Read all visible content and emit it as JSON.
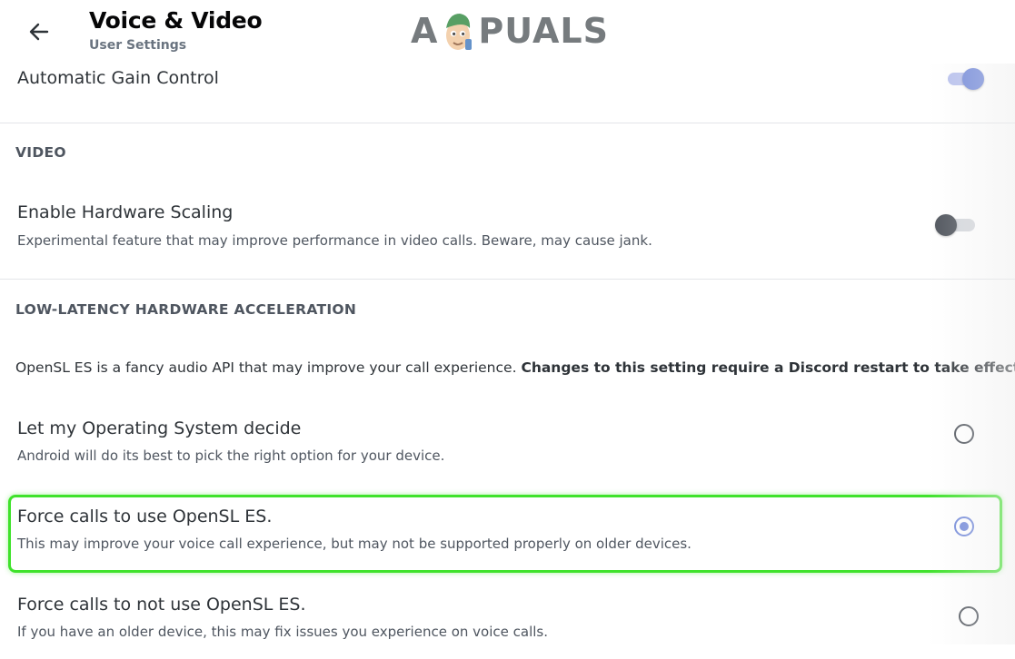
{
  "header": {
    "title": "Voice & Video",
    "subtitle": "User Settings",
    "back_icon": "arrow-left-icon"
  },
  "watermark": {
    "text_left": "A",
    "text_right": "PUALS"
  },
  "agc": {
    "label": "Automatic Gain Control",
    "enabled": true
  },
  "video": {
    "section_title": "VIDEO",
    "hw_scaling": {
      "label": "Enable Hardware Scaling",
      "description": "Experimental feature that may improve performance in video calls. Beware, may cause jank.",
      "enabled": false
    }
  },
  "low_latency": {
    "section_title": "LOW-LATENCY HARDWARE ACCELERATION",
    "note_plain": "OpenSL ES is a fancy audio API that may improve your call experience.",
    "note_bold": "Changes to this setting require a Discord restart to take effect!",
    "options": [
      {
        "label": "Let my Operating System decide",
        "description": "Android will do its best to pick the right option for your device.",
        "selected": false
      },
      {
        "label": "Force calls to use OpenSL ES.",
        "description": "This may improve your voice call experience, but may not be supported properly on older devices.",
        "selected": true
      },
      {
        "label": "Force calls to not use OpenSL ES.",
        "description": "If you have an older device, this may fix issues you experience on voice calls.",
        "selected": false
      }
    ]
  },
  "colors": {
    "accent": "#7289da",
    "highlight": "#3fe22b"
  }
}
